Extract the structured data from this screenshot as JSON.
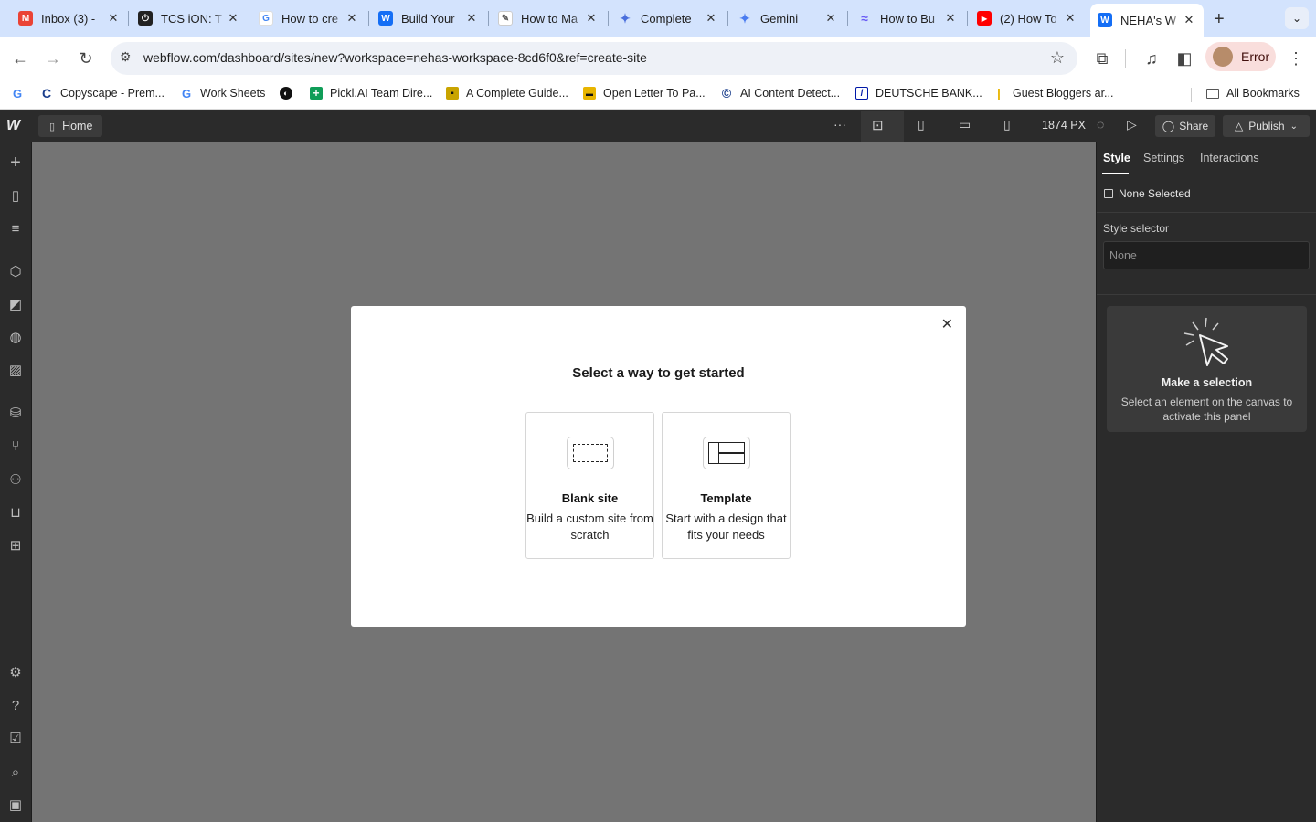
{
  "browser": {
    "tabs": [
      {
        "title": "Inbox (3) -",
        "favicon": "gmail-icon",
        "color": "#ea4335",
        "glyph": "M"
      },
      {
        "title": "TCS iON: T",
        "favicon": "power-icon",
        "color": "#222222",
        "glyph": "⏻"
      },
      {
        "title": "How to cre",
        "favicon": "google-icon",
        "color": "#4285f4",
        "glyph": "G"
      },
      {
        "title": "Build Your",
        "favicon": "webflow-icon",
        "color": "#146ef5",
        "glyph": "W"
      },
      {
        "title": "How to Ma",
        "favicon": "document-icon",
        "color": "#777777",
        "glyph": "✎"
      },
      {
        "title": "Complete",
        "favicon": "sparkle-icon",
        "color": "#4a6fdc",
        "glyph": "✦"
      },
      {
        "title": "Gemini",
        "favicon": "gemini-icon",
        "color": "#4a7cf0",
        "glyph": "✦"
      },
      {
        "title": "How to Bu",
        "favicon": "wave-icon",
        "color": "#6a5cf5",
        "glyph": "≈"
      },
      {
        "title": "(2) How To",
        "favicon": "youtube-icon",
        "color": "#ff0000",
        "glyph": "▶"
      },
      {
        "title": "NEHA's W",
        "favicon": "webflow-icon",
        "color": "#146ef5",
        "glyph": "W"
      }
    ],
    "url": "webflow.com/dashboard/sites/new?workspace=nehas-workspace-8cd6f0&ref=create-site",
    "profile_label": "Error",
    "bookmarks": [
      {
        "label": "",
        "icon": "google-icon",
        "color": "#4285f4",
        "glyph": "G"
      },
      {
        "label": "Copyscape - Prem...",
        "icon": "copyscape-icon",
        "color": "#1a3e8c",
        "glyph": "C"
      },
      {
        "label": "Work Sheets",
        "icon": "google-icon",
        "color": "#4285f4",
        "glyph": "G"
      },
      {
        "label": "",
        "icon": "medium-icon",
        "color": "#111111",
        "glyph": "◐"
      },
      {
        "label": "Pickl.AI Team Dire...",
        "icon": "sheets-icon",
        "color": "#0f9d58",
        "glyph": "+"
      },
      {
        "label": "A Complete Guide...",
        "icon": "bookmark-icon",
        "color": "#c9a400",
        "glyph": "▪"
      },
      {
        "label": "Open Letter To Pa...",
        "icon": "bookmark-icon",
        "color": "#e8b500",
        "glyph": "▬"
      },
      {
        "label": "AI Content Detect...",
        "icon": "copyright-icon",
        "color": "#1a3e8c",
        "glyph": "©"
      },
      {
        "label": "DEUTSCHE BANK...",
        "icon": "deutsche-bank-icon",
        "color": "#0018a8",
        "glyph": "/"
      },
      {
        "label": "Guest Bloggers ar...",
        "icon": "bookmark-icon",
        "color": "#e8b500",
        "glyph": "|"
      }
    ],
    "all_bookmarks": "All Bookmarks"
  },
  "designer": {
    "page_label": "Home",
    "canvas_width": "1874 PX",
    "share_label": "Share",
    "publish_label": "Publish",
    "panel_tabs": [
      "Style",
      "Settings",
      "Interactions"
    ],
    "none_selected": "None Selected",
    "style_selector_label": "Style selector",
    "style_selector_placeholder": "None",
    "empty_title": "Make a selection",
    "empty_text": "Select an element on the canvas to activate this panel"
  },
  "modal": {
    "title": "Select a way to get started",
    "options": [
      {
        "name": "Blank site",
        "description": "Build a custom site from scratch"
      },
      {
        "name": "Template",
        "description": "Start with a design that fits your needs"
      }
    ]
  }
}
